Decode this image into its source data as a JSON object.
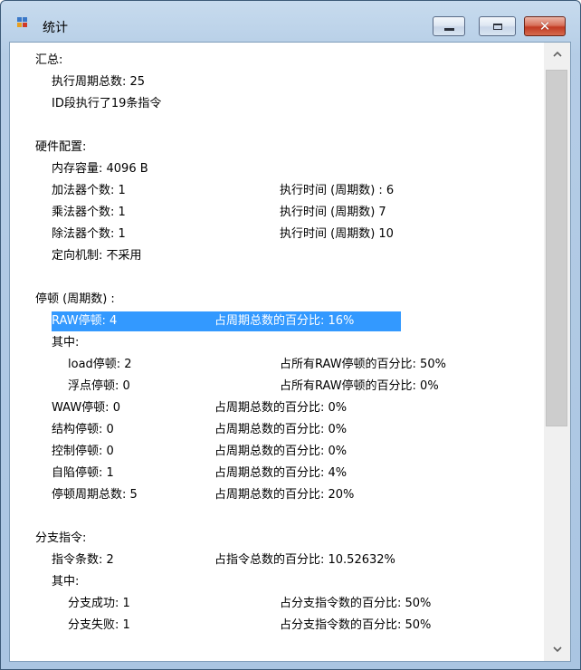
{
  "window": {
    "title": "统计",
    "icon": "app-window-icon",
    "buttons": {
      "minimize": "minimize-icon",
      "maximize": "maximize-icon",
      "close": "close-icon"
    }
  },
  "stats": {
    "summary_header": "汇总:",
    "total_cycles": "执行周期总数: 25",
    "id_stage": "ID段执行了19条指令",
    "hardware_header": "硬件配置:",
    "memory": "内存容量: 4096 B",
    "adder_count": "加法器个数: 1",
    "adder_time": "执行时间 (周期数) : 6",
    "multiplier_count": "乘法器个数: 1",
    "multiplier_time": "执行时间 (周期数) 7",
    "divider_count": "除法器个数: 1",
    "divider_time": "执行时间 (周期数) 10",
    "forwarding": "定向机制: 不采用",
    "stall_header": "停顿 (周期数) :",
    "raw_stall": "RAW停顿: 4",
    "raw_pct": "占周期总数的百分比: 16%",
    "raw_among": "其中:",
    "load_stall": "load停顿: 2",
    "load_pct": "占所有RAW停顿的百分比: 50%",
    "fp_stall": "浮点停顿: 0",
    "fp_pct": "占所有RAW停顿的百分比: 0%",
    "waw_stall": "WAW停顿: 0",
    "waw_pct": "占周期总数的百分比: 0%",
    "struct_stall": "结构停顿: 0",
    "struct_pct": "占周期总数的百分比: 0%",
    "control_stall": "控制停顿: 0",
    "control_pct": "占周期总数的百分比: 0%",
    "trap_stall": "自陷停顿: 1",
    "trap_pct": "占周期总数的百分比: 4%",
    "total_stall": "停顿周期总数: 5",
    "total_stall_pct": "占周期总数的百分比: 20%",
    "branch_header": "分支指令:",
    "branch_count": "指令条数: 2",
    "branch_pct": "占指令总数的百分比: 10.52632%",
    "branch_among": "其中:",
    "branch_taken": "分支成功: 1",
    "branch_taken_pct": "占分支指令数的百分比: 50%",
    "branch_not_taken": "分支失败: 1",
    "branch_not_taken_pct": "占分支指令数的百分比: 50%"
  },
  "colors": {
    "selection": "#3399ff",
    "close_button": "#c13a23",
    "frame": "#b5cde6"
  }
}
